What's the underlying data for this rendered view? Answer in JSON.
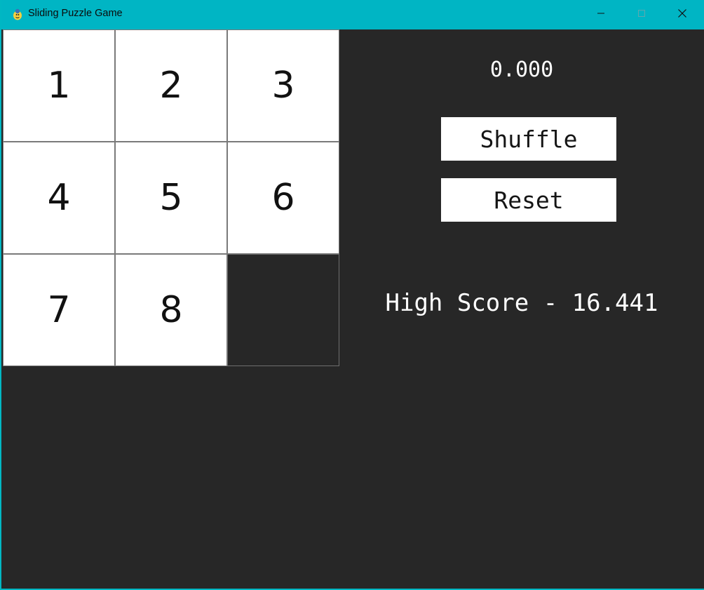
{
  "window": {
    "title": "Sliding Puzzle Game",
    "controls": {
      "minimize_icon": "minimize-icon",
      "maximize_icon": "maximize-icon",
      "close_icon": "close-icon"
    }
  },
  "board": {
    "size": 3,
    "tiles": [
      "1",
      "2",
      "3",
      "4",
      "5",
      "6",
      "7",
      "8",
      ""
    ]
  },
  "timer": "0.000",
  "buttons": {
    "shuffle": "Shuffle",
    "reset": "Reset"
  },
  "high_score": {
    "label": "High Score",
    "separator": " - ",
    "value": "16.441"
  },
  "colors": {
    "titlebar": "#00b5c4",
    "background": "#272727",
    "tile": "#ffffff",
    "tile_border": "#7a7a7a",
    "text_light": "#ffffff",
    "text_dark": "#111111"
  }
}
